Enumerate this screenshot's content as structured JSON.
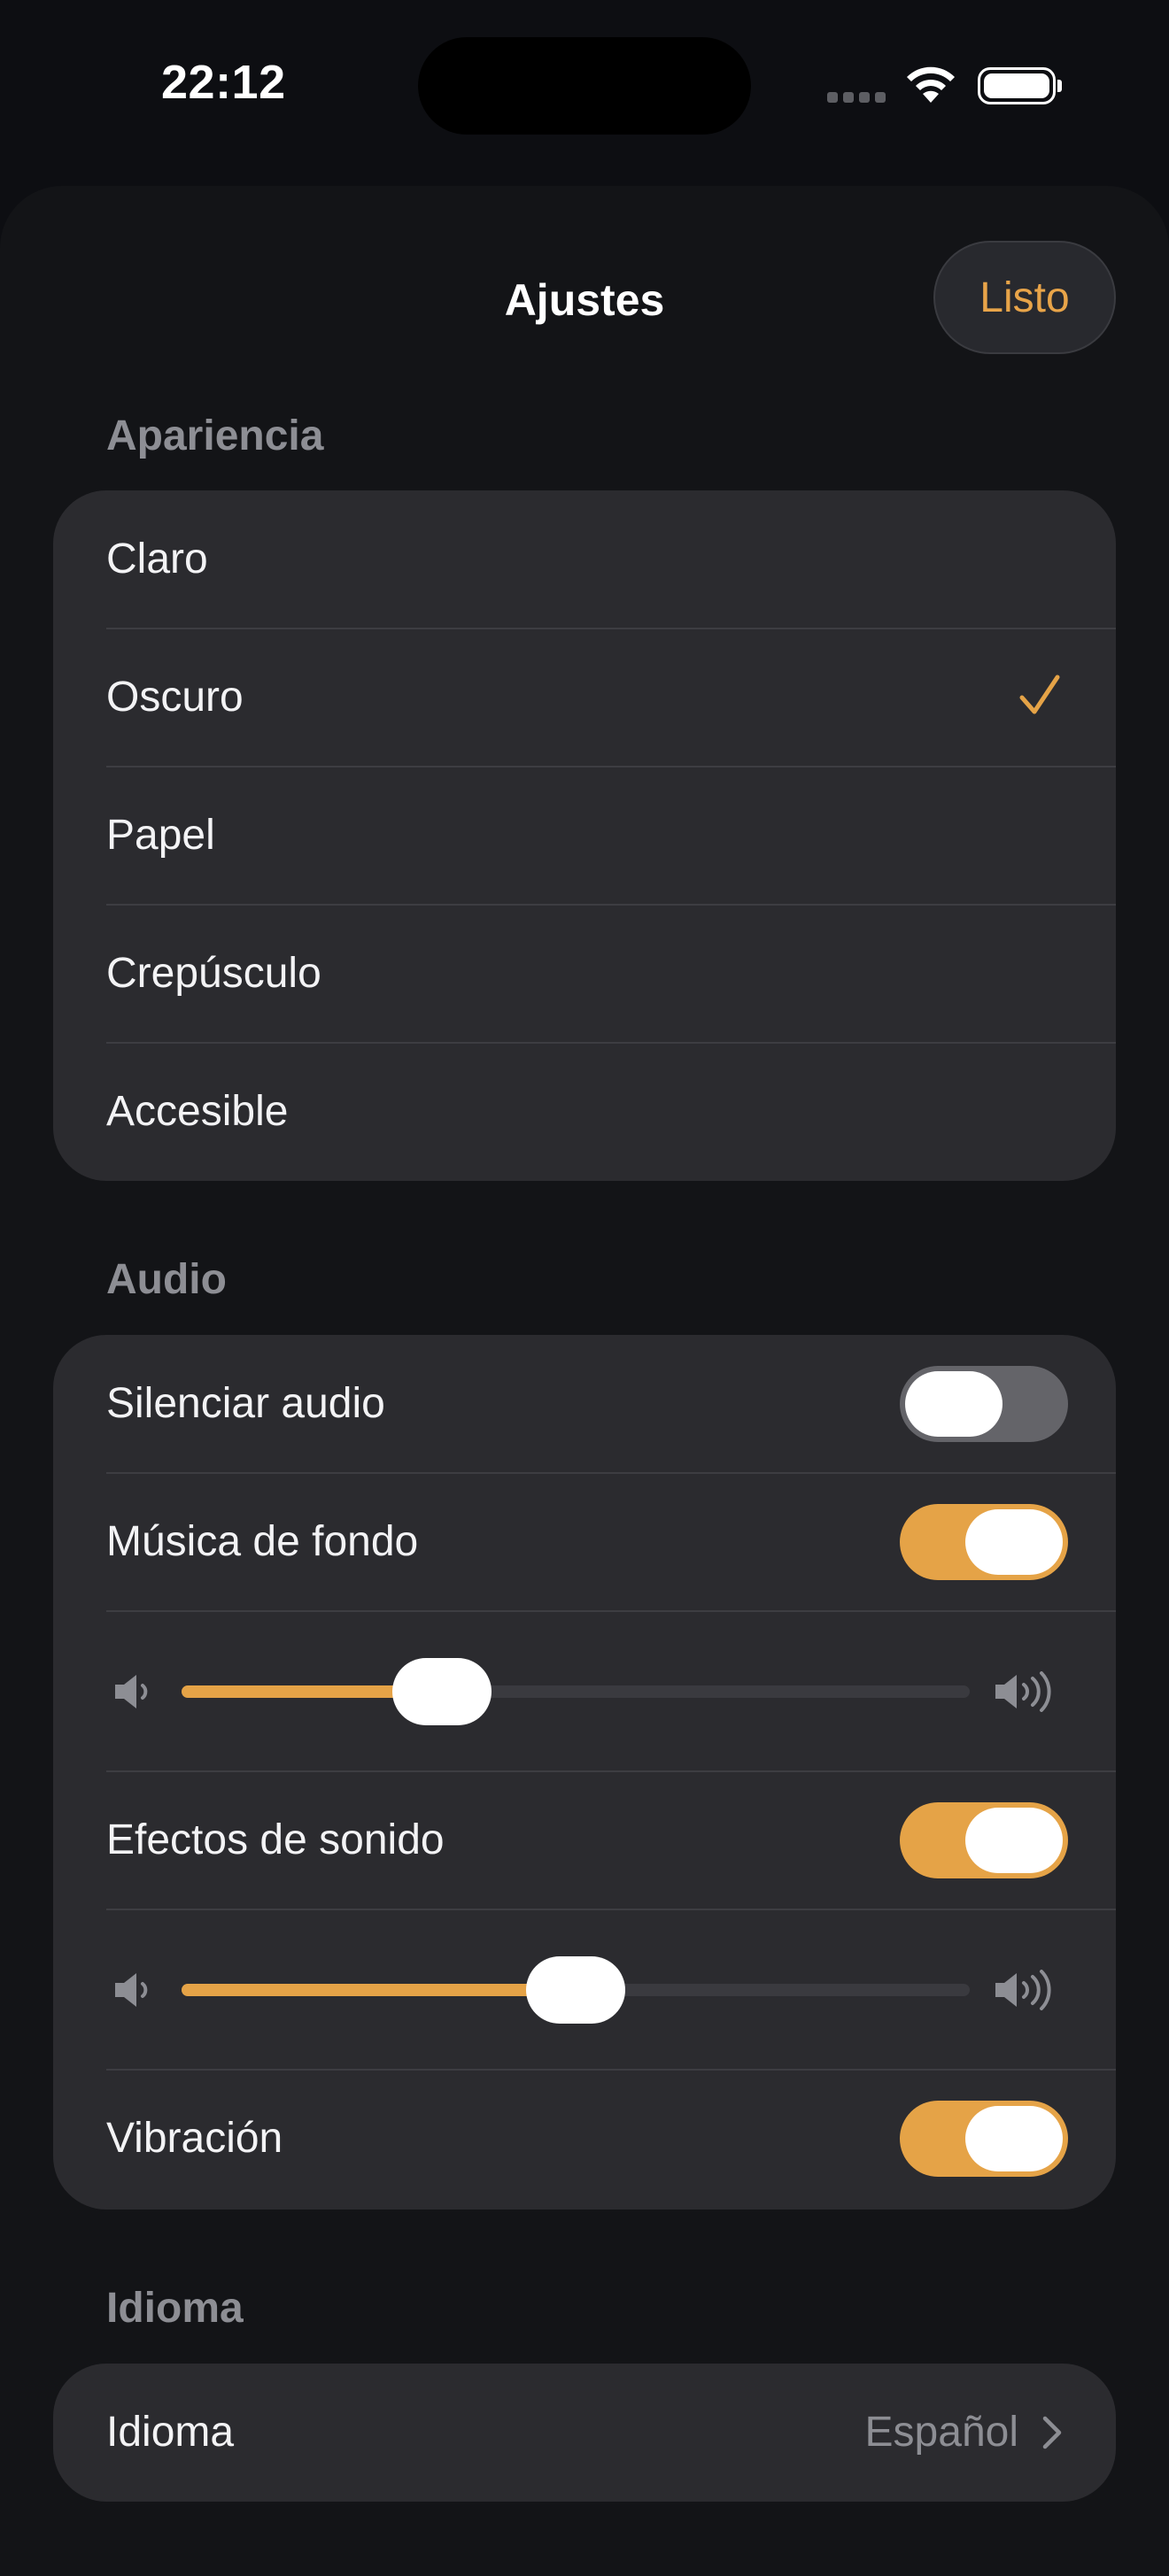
{
  "status": {
    "time": "22:12"
  },
  "sheet": {
    "title": "Ajustes",
    "done_label": "Listo"
  },
  "appearance": {
    "header": "Apariencia",
    "options": [
      {
        "label": "Claro",
        "selected": false
      },
      {
        "label": "Oscuro",
        "selected": true
      },
      {
        "label": "Papel",
        "selected": false
      },
      {
        "label": "Crepúsculo",
        "selected": false
      },
      {
        "label": "Accesible",
        "selected": false
      }
    ]
  },
  "audio": {
    "header": "Audio",
    "mute": {
      "label": "Silenciar audio",
      "on": false
    },
    "music": {
      "label": "Música de fondo",
      "on": true,
      "volume": 0.33
    },
    "sfx": {
      "label": "Efectos de sonido",
      "on": true,
      "volume": 0.5
    },
    "vibration": {
      "label": "Vibración",
      "on": true
    }
  },
  "language": {
    "header": "Idioma",
    "row_label": "Idioma",
    "value": "Español"
  },
  "colors": {
    "accent": "#e5a347",
    "background": "#0d0e12",
    "group": "#2b2b2f",
    "secondary_text": "#8d8e94"
  },
  "icons": {
    "check": "checkmark-icon",
    "volume_low": "speaker-low-icon",
    "volume_high": "speaker-high-icon",
    "chevron": "chevron-right-icon"
  }
}
